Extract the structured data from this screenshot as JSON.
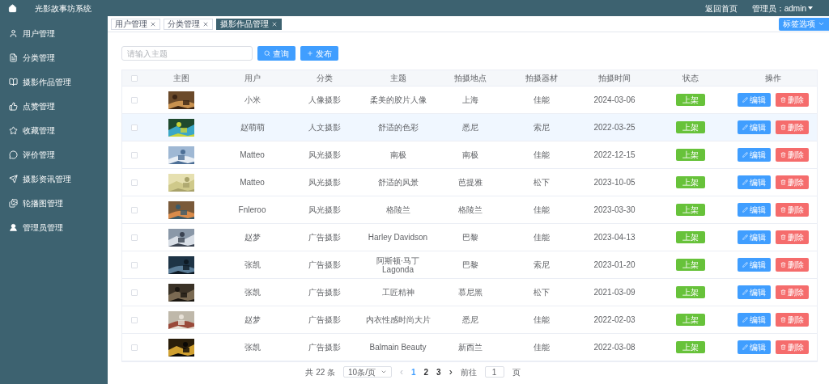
{
  "app_title": "光影故事坊系统",
  "top_links": [
    {
      "label": "返回首页"
    },
    {
      "label": "管理员：admin"
    }
  ],
  "sidebar": {
    "items": [
      {
        "label": "用户管理",
        "kind": "user"
      },
      {
        "label": "分类管理",
        "kind": "doc"
      },
      {
        "label": "摄影作品管理",
        "kind": "book"
      },
      {
        "label": "点赞管理",
        "kind": "like"
      },
      {
        "label": "收藏管理",
        "kind": "star"
      },
      {
        "label": "评价管理",
        "kind": "chat"
      },
      {
        "label": "摄影资讯管理",
        "kind": "send"
      },
      {
        "label": "轮播图管理"
      },
      {
        "label": "管理员管理",
        "kind": "admin"
      }
    ]
  },
  "tabs": [
    {
      "label": "用户管理",
      "selected": false
    },
    {
      "label": "分类管理",
      "selected": false
    },
    {
      "label": "摄影作品管理",
      "selected": true
    }
  ],
  "tab_options": "标签选项",
  "search": {
    "placeholder": "请输入主题"
  },
  "buttons": [
    {
      "label": "查询",
      "kind": "search"
    },
    {
      "label": "发布",
      "kind": "add"
    }
  ],
  "table": {
    "select_all": {
      "checked": false
    },
    "columns": [
      "主图",
      "用户",
      "分类",
      "主题",
      "拍摄地点",
      "拍摄器材",
      "拍摄时间",
      "状态",
      "操作"
    ],
    "rows": [
      {
        "checked": false,
        "highlighted": false,
        "cells": [
          {
            "kind": "picture"
          },
          {
            "kind": "text",
            "text": "小米"
          },
          {
            "kind": "text",
            "text": "人像摄影"
          },
          {
            "kind": "text",
            "text": "柔美的胶片人像"
          },
          {
            "kind": "text",
            "text": "上海"
          },
          {
            "kind": "text",
            "text": "佳能"
          },
          {
            "kind": "text",
            "text": "2024-03-06"
          },
          {
            "kind": "status",
            "text": "上架"
          },
          {
            "kind": "actions",
            "edit": "编辑",
            "delete": "删除"
          }
        ]
      },
      {
        "checked": false,
        "highlighted": true,
        "cells": [
          {
            "kind": "picture"
          },
          {
            "kind": "text",
            "text": "赵萌萌"
          },
          {
            "kind": "text",
            "text": "人文摄影"
          },
          {
            "kind": "text",
            "text": "舒适的色彩"
          },
          {
            "kind": "text",
            "text": "悉尼"
          },
          {
            "kind": "text",
            "text": "索尼"
          },
          {
            "kind": "text",
            "text": "2022-03-25"
          },
          {
            "kind": "status",
            "text": "上架"
          },
          {
            "kind": "actions",
            "edit": "编辑",
            "delete": "删除"
          }
        ]
      },
      {
        "checked": false,
        "highlighted": false,
        "cells": [
          {
            "kind": "picture"
          },
          {
            "kind": "text",
            "text": "Matteo"
          },
          {
            "kind": "text",
            "text": "风光摄影"
          },
          {
            "kind": "text",
            "text": "南极"
          },
          {
            "kind": "text",
            "text": "南极"
          },
          {
            "kind": "text",
            "text": "佳能"
          },
          {
            "kind": "text",
            "text": "2022-12-15"
          },
          {
            "kind": "status",
            "text": "上架"
          },
          {
            "kind": "actions",
            "edit": "编辑",
            "delete": "删除"
          }
        ]
      },
      {
        "checked": false,
        "highlighted": false,
        "cells": [
          {
            "kind": "picture"
          },
          {
            "kind": "text",
            "text": "Matteo"
          },
          {
            "kind": "text",
            "text": "风光摄影"
          },
          {
            "kind": "text",
            "text": "舒适的风景"
          },
          {
            "kind": "text",
            "text": "芭提雅"
          },
          {
            "kind": "text",
            "text": "松下"
          },
          {
            "kind": "text",
            "text": "2023-10-05"
          },
          {
            "kind": "status",
            "text": "上架"
          },
          {
            "kind": "actions",
            "edit": "编辑",
            "delete": "删除"
          }
        ]
      },
      {
        "checked": false,
        "highlighted": false,
        "cells": [
          {
            "kind": "picture"
          },
          {
            "kind": "text",
            "text": "Fnleroo"
          },
          {
            "kind": "text",
            "text": "风光摄影"
          },
          {
            "kind": "text",
            "text": "格陵兰"
          },
          {
            "kind": "text",
            "text": "格陵兰"
          },
          {
            "kind": "text",
            "text": "佳能"
          },
          {
            "kind": "text",
            "text": "2023-03-30"
          },
          {
            "kind": "status",
            "text": "上架"
          },
          {
            "kind": "actions",
            "edit": "编辑",
            "delete": "删除"
          }
        ]
      },
      {
        "checked": false,
        "highlighted": false,
        "cells": [
          {
            "kind": "picture"
          },
          {
            "kind": "text",
            "text": "赵梦"
          },
          {
            "kind": "text",
            "text": "广告摄影"
          },
          {
            "kind": "text",
            "text": "Harley Davidson"
          },
          {
            "kind": "text",
            "text": "巴黎"
          },
          {
            "kind": "text",
            "text": "佳能"
          },
          {
            "kind": "text",
            "text": "2023-04-13"
          },
          {
            "kind": "status",
            "text": "上架"
          },
          {
            "kind": "actions",
            "edit": "编辑",
            "delete": "删除"
          }
        ]
      },
      {
        "checked": false,
        "highlighted": false,
        "cells": [
          {
            "kind": "picture"
          },
          {
            "kind": "text",
            "text": "张凯"
          },
          {
            "kind": "text",
            "text": "广告摄影"
          },
          {
            "kind": "text",
            "text": "阿斯顿·马丁Lagonda"
          },
          {
            "kind": "text",
            "text": "巴黎"
          },
          {
            "kind": "text",
            "text": "索尼"
          },
          {
            "kind": "text",
            "text": "2023-01-20"
          },
          {
            "kind": "status",
            "text": "上架"
          },
          {
            "kind": "actions",
            "edit": "编辑",
            "delete": "删除"
          }
        ]
      },
      {
        "checked": false,
        "highlighted": false,
        "cells": [
          {
            "kind": "picture"
          },
          {
            "kind": "text",
            "text": "张凯"
          },
          {
            "kind": "text",
            "text": "广告摄影"
          },
          {
            "kind": "text",
            "text": "工匠精神"
          },
          {
            "kind": "text",
            "text": "慕尼黑"
          },
          {
            "kind": "text",
            "text": "松下"
          },
          {
            "kind": "text",
            "text": "2021-03-09"
          },
          {
            "kind": "status",
            "text": "上架"
          },
          {
            "kind": "actions",
            "edit": "编辑",
            "delete": "删除"
          }
        ]
      },
      {
        "checked": false,
        "highlighted": false,
        "cells": [
          {
            "kind": "picture"
          },
          {
            "kind": "text",
            "text": "赵梦"
          },
          {
            "kind": "text",
            "text": "广告摄影"
          },
          {
            "kind": "text",
            "text": "内衣性感时尚大片"
          },
          {
            "kind": "text",
            "text": "悉尼"
          },
          {
            "kind": "text",
            "text": "佳能"
          },
          {
            "kind": "text",
            "text": "2022-02-03"
          },
          {
            "kind": "status",
            "text": "上架"
          },
          {
            "kind": "actions",
            "edit": "编辑",
            "delete": "删除"
          }
        ]
      },
      {
        "checked": false,
        "highlighted": false,
        "cells": [
          {
            "kind": "picture"
          },
          {
            "kind": "text",
            "text": "张凯"
          },
          {
            "kind": "text",
            "text": "广告摄影"
          },
          {
            "kind": "text",
            "text": "Balmain Beauty"
          },
          {
            "kind": "text",
            "text": "新西兰"
          },
          {
            "kind": "text",
            "text": "佳能"
          },
          {
            "kind": "text",
            "text": "2022-03-08"
          },
          {
            "kind": "status",
            "text": "上架"
          },
          {
            "kind": "actions",
            "edit": "编辑",
            "delete": "删除"
          }
        ]
      }
    ]
  },
  "pagination": {
    "total": "共 22 条",
    "page_size": "10条/页",
    "prev": "‹",
    "pages": [
      {
        "label": "1",
        "selected": true
      },
      {
        "label": "2",
        "selected": false
      },
      {
        "label": "3",
        "selected": false
      }
    ],
    "next": "›",
    "goto_label": "前往",
    "goto_value": "1",
    "page_unit": "页"
  }
}
